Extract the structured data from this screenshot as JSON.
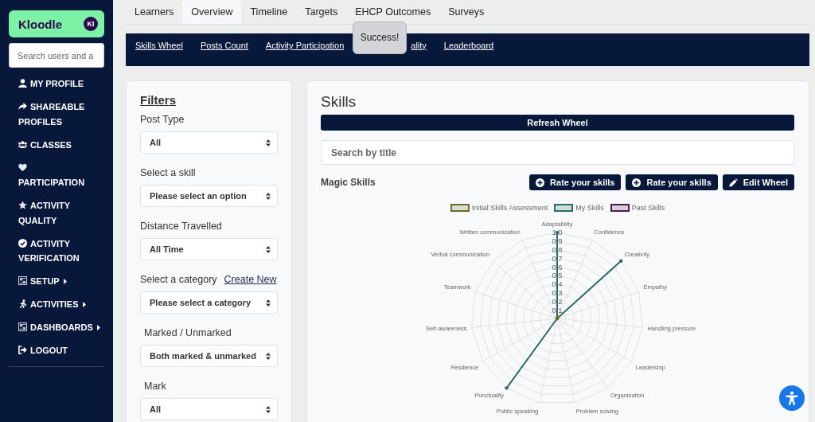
{
  "sidebar": {
    "brand": {
      "name": "Kloodle",
      "initials": "KI"
    },
    "search": {
      "placeholder": "Search users and a"
    },
    "items": [
      {
        "label": "MY PROFILE",
        "submenu": false
      },
      {
        "label": "SHAREABLE PROFILES",
        "submenu": false
      },
      {
        "label": "CLASSES",
        "submenu": false
      },
      {
        "label": "PARTICIPATION",
        "submenu": false
      },
      {
        "label": "ACTIVITY QUALITY",
        "submenu": false
      },
      {
        "label": "ACTIVITY VERIFICATION",
        "submenu": false
      },
      {
        "label": "SETUP",
        "submenu": true
      },
      {
        "label": "ACTIVITIES",
        "submenu": true
      },
      {
        "label": "DASHBOARDS",
        "submenu": true
      },
      {
        "label": "LOGOUT",
        "submenu": false
      }
    ]
  },
  "tabs": [
    {
      "label": "Learners",
      "selected": false
    },
    {
      "label": "Overview",
      "selected": true
    },
    {
      "label": "Timeline",
      "selected": false
    },
    {
      "label": "Targets",
      "selected": false
    },
    {
      "label": "EHCP Outcomes",
      "selected": false
    },
    {
      "label": "Surveys",
      "selected": false
    }
  ],
  "subnav": {
    "links": [
      {
        "label": "Skills Wheel"
      },
      {
        "label": "Posts Count"
      },
      {
        "label": "Activity Participation"
      },
      {
        "label": "ality"
      },
      {
        "label": "Leaderboard"
      }
    ]
  },
  "toast": {
    "text": "Success!"
  },
  "filters": {
    "title": "Filters",
    "groups": [
      {
        "label": "Post Type",
        "value": "All"
      },
      {
        "label": "Select a skill",
        "value": "Please select an option"
      },
      {
        "label": "Distance Travelled",
        "value": "All Time"
      },
      {
        "label": "Select a category",
        "link": "Create New",
        "value": "Please select a category"
      }
    ],
    "marking": [
      {
        "label": "Marked / Unmarked",
        "value": "Both marked & unmarked"
      },
      {
        "label": "Mark",
        "value": "All"
      }
    ]
  },
  "skills": {
    "title": "Skills",
    "refresh_button": "Refresh Wheel",
    "search": {
      "placeholder": "Search by title"
    },
    "wheel_name": "Magic Skills",
    "actions": [
      {
        "label": "Rate your skills",
        "kind": "add"
      },
      {
        "label": "Rate your skills",
        "kind": "add"
      },
      {
        "label": "Edit Wheel",
        "kind": "edit"
      }
    ],
    "wheel": {
      "scale_labels": [
        "1.0",
        "0.9",
        "0.8",
        "0.7",
        "0.6",
        "0.5",
        "0.4",
        "0.3",
        "0.2",
        "0.1"
      ],
      "axes": [
        {
          "label": "Adaptability"
        },
        {
          "label": "Written communication"
        },
        {
          "label": "Confidence"
        },
        {
          "label": "Verbal communication"
        },
        {
          "label": "Creativity"
        },
        {
          "label": "Teamwork"
        },
        {
          "label": "Empathy"
        },
        {
          "label": "Self-awareness"
        },
        {
          "label": "Handling pressure"
        },
        {
          "label": "Resilience"
        },
        {
          "label": "Leadership"
        },
        {
          "label": "Punctuality"
        },
        {
          "label": "Organization"
        },
        {
          "label": "Public speaking"
        },
        {
          "label": "Problem solving"
        }
      ],
      "series": [
        {
          "name": "Initial Skills Assessment",
          "color": "#6e6c2b",
          "points": [
            {
              "full": false
            },
            {
              "full": false
            },
            {
              "full": false
            },
            {
              "full": false
            },
            {
              "full": false
            },
            {
              "full": false
            },
            {
              "full": false
            },
            {
              "full": false
            },
            {
              "full": false
            },
            {
              "full": false
            },
            {
              "full": false
            },
            {
              "full": false
            },
            {
              "full": false
            },
            {
              "full": false
            },
            {
              "full": false
            }
          ]
        },
        {
          "name": "My Skills",
          "color": "#2f6b62",
          "points": [
            {
              "full": true
            },
            {
              "full": false
            },
            {
              "full": false
            },
            {
              "full": false
            },
            {
              "full": true
            },
            {
              "full": false
            },
            {
              "full": false
            },
            {
              "full": false
            },
            {
              "full": false
            },
            {
              "full": false
            },
            {
              "full": false
            },
            {
              "full": true
            },
            {
              "full": false
            },
            {
              "full": false
            },
            {
              "full": false
            }
          ]
        },
        {
          "name": "Past Skills",
          "color": "#4b1c4b"
        }
      ]
    }
  }
}
